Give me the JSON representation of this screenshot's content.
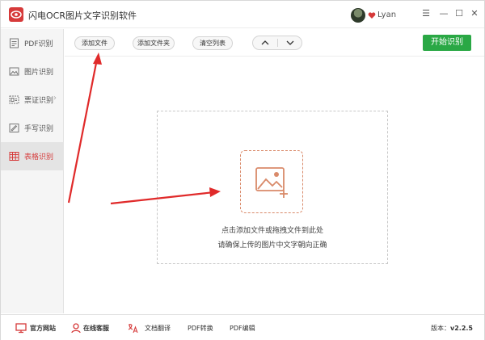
{
  "app": {
    "title": "闪电OCR图片文字识别软件",
    "username": "Lyan",
    "accent_color": "#d63a3a",
    "green_color": "#2aa845"
  },
  "window_controls": {
    "menu": "☰",
    "minimize": "—",
    "maximize": "☐",
    "close": "✕"
  },
  "sidebar": {
    "items": [
      {
        "label": "PDF识别",
        "icon": "pdf-icon",
        "active": false
      },
      {
        "label": "图片识别",
        "icon": "image-icon",
        "active": false
      },
      {
        "label": "票证识别",
        "icon": "ticket-icon",
        "active": false,
        "has_submenu": true
      },
      {
        "label": "手写识别",
        "icon": "handwriting-icon",
        "active": false
      },
      {
        "label": "表格识别",
        "icon": "table-icon",
        "active": true
      }
    ]
  },
  "toolbar": {
    "add_file": "添加文件",
    "add_folder": "添加文件夹",
    "clear_list": "清空列表",
    "start": "开始识别"
  },
  "dropzone": {
    "line1": "点击添加文件或拖拽文件到此处",
    "line2": "请确保上传的图片中文字朝向正确"
  },
  "footer": {
    "website": "官方网站",
    "support": "在线客服",
    "translate": "文档翻译",
    "pdf_convert": "PDF转换",
    "pdf_edit": "PDF编辑",
    "version_label": "版本：",
    "version": "v2.2.5"
  }
}
